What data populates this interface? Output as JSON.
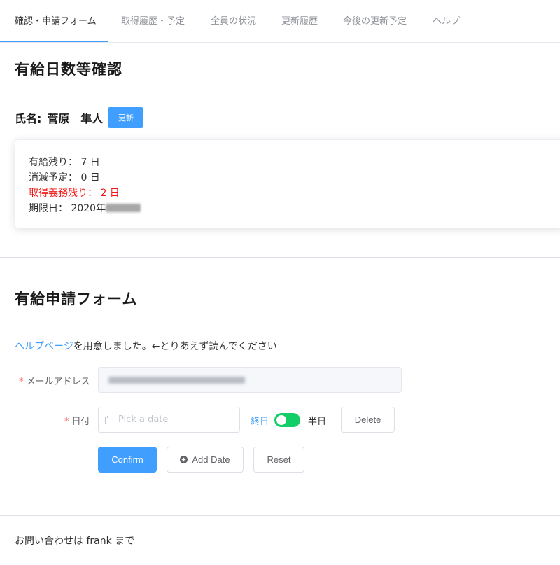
{
  "tabs": [
    {
      "label": "確認・申請フォーム",
      "active": true
    },
    {
      "label": "取得履歴・予定",
      "active": false
    },
    {
      "label": "全員の状況",
      "active": false
    },
    {
      "label": "更新履歴",
      "active": false
    },
    {
      "label": "今後の更新予定",
      "active": false
    },
    {
      "label": "ヘルプ",
      "active": false
    }
  ],
  "confirm": {
    "heading": "有給日数等確認",
    "name_label": "氏名:",
    "name_value": "菅原　隼人",
    "update_button": "更新"
  },
  "summary": {
    "remaining": "有給残り： 7 日",
    "expiring": "消滅予定： 0 日",
    "mandatory_remaining": "取得義務残り： 2 日",
    "deadline": "期限日： 2020年"
  },
  "form": {
    "heading": "有給申請フォーム",
    "help_link": "ヘルプページ",
    "help_text": "を用意しました。←とりあえず読んでください",
    "email_label": "メールアドレス",
    "date_label": "日付",
    "date_placeholder": "Pick a date",
    "full_day": "終日",
    "half_day": "半日",
    "delete_button": "Delete",
    "confirm_button": "Confirm",
    "add_date_button": "Add Date",
    "reset_button": "Reset"
  },
  "footer": {
    "text": "お問い合わせは frank まで"
  },
  "icons": {
    "calendar": "calendar-icon",
    "add": "plus-circle-icon"
  },
  "colors": {
    "primary": "#409eff",
    "danger": "#f31818",
    "switch_on": "#13ce66"
  }
}
